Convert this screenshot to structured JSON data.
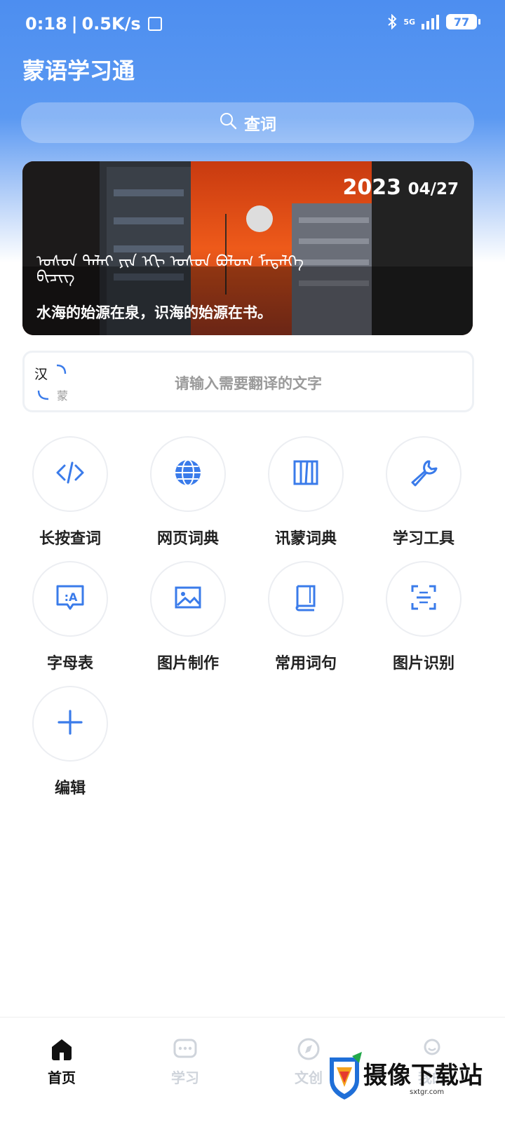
{
  "status_bar": {
    "time": "0:18",
    "speed": "0.5K/s",
    "network": "5G",
    "battery": "77"
  },
  "app": {
    "title": "蒙语学习通"
  },
  "search": {
    "label": "查词"
  },
  "banner": {
    "year": "2023",
    "month_day": "04/27",
    "mongolian_line1": "ᠤᠰᠤᠨ ᠳᠠᠯᠠᠢ ᠶᠢᠨ ᠡᠬᠢ ᠤᠰᠤᠨ ᠪᠤᠯᠤᠭ ᠮᠡᠳᠡᠯᠭᠡ",
    "mongolian_line2": "ᠪᠢᠴᠢᠭ",
    "quote": "水海的始源在泉，识海的始源在书。"
  },
  "translate": {
    "from": "汉",
    "to": "蒙",
    "placeholder": "请输入需要翻译的文字"
  },
  "tools": [
    {
      "label": "长按查词",
      "icon": "code-icon"
    },
    {
      "label": "网页词典",
      "icon": "globe-icon"
    },
    {
      "label": "讯蒙词典",
      "icon": "books-icon"
    },
    {
      "label": "学习工具",
      "icon": "wrench-icon"
    },
    {
      "label": "字母表",
      "icon": "alphabet-icon"
    },
    {
      "label": "图片制作",
      "icon": "image-icon"
    },
    {
      "label": "常用词句",
      "icon": "book-icon"
    },
    {
      "label": "图片识别",
      "icon": "scan-icon"
    },
    {
      "label": "编辑",
      "icon": "plus-icon"
    }
  ],
  "nav": [
    {
      "label": "首页",
      "icon": "home-icon",
      "active": true
    },
    {
      "label": "学习",
      "icon": "chat-icon",
      "active": false
    },
    {
      "label": "文创",
      "icon": "compass-icon",
      "active": false
    },
    {
      "label": "我的",
      "icon": "user-icon",
      "active": false
    }
  ],
  "watermark": {
    "text": "摄像下载站",
    "url": "sxtgr.com"
  },
  "colors": {
    "accent": "#4d8ef0",
    "icon_blue": "#3a7bea"
  }
}
